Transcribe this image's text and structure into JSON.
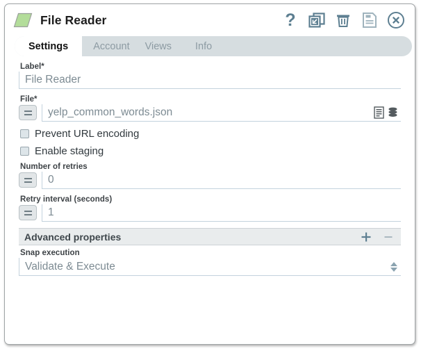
{
  "window": {
    "title": "File Reader",
    "icon": "snap-parallelogram-icon"
  },
  "titlebar_actions": [
    {
      "name": "help-icon",
      "label": "?"
    },
    {
      "name": "duplicate-icon",
      "label": "Duplicate"
    },
    {
      "name": "delete-icon",
      "label": "Delete"
    },
    {
      "name": "save-icon",
      "label": "Save"
    },
    {
      "name": "close-icon",
      "label": "Close"
    }
  ],
  "tabs": [
    {
      "label": "Settings",
      "active": true
    },
    {
      "label": "Account",
      "active": false
    },
    {
      "label": "Views",
      "active": false
    },
    {
      "label": "Info",
      "active": false
    }
  ],
  "form": {
    "label_field": {
      "label": "Label*",
      "value": "File Reader"
    },
    "file_field": {
      "label": "File*",
      "value": "yelp_common_words.json",
      "expression_button": "=",
      "icons": [
        {
          "name": "file-browse-icon"
        },
        {
          "name": "database-icon"
        }
      ]
    },
    "checkboxes": [
      {
        "label": "Prevent URL encoding",
        "checked": false
      },
      {
        "label": "Enable staging",
        "checked": false
      }
    ],
    "retries_field": {
      "label": "Number of retries",
      "value": "0",
      "expression_button": "="
    },
    "retry_interval_field": {
      "label": "Retry interval (seconds)",
      "value": "1",
      "expression_button": "="
    },
    "advanced_properties": {
      "title": "Advanced properties",
      "add_label": "+",
      "remove_label": "−"
    },
    "snap_execution": {
      "label": "Snap execution",
      "value": "Validate & Execute"
    }
  },
  "colors": {
    "accent": "#5d7f91",
    "snap_green": "#b3dd9a",
    "tabbar_bg": "#d6dde0",
    "adv_bar_bg": "#e9eced"
  }
}
